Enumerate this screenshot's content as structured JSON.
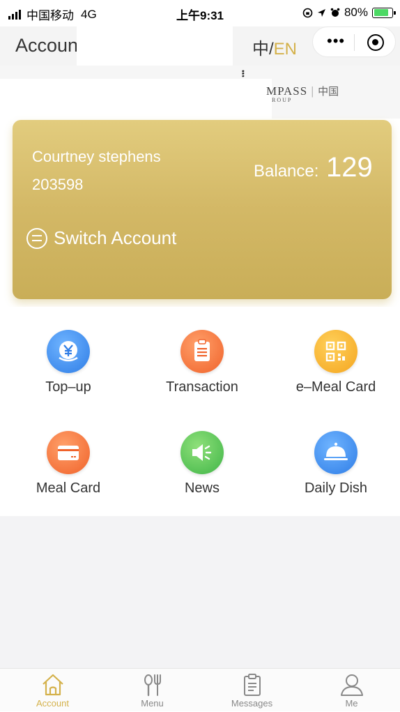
{
  "status_bar": {
    "carrier": "中国移动",
    "network": "4G",
    "time": "上午9:31",
    "battery": "80%"
  },
  "nav": {
    "title": "Accoun",
    "lang_zh": "中",
    "lang_sep": "/",
    "lang_en": "EN",
    "more_icon": "ellipsis-icon",
    "close_icon": "target-icon",
    "active_lang_color": "#d4b14a"
  },
  "banner": {
    "logo_text": "MPASS",
    "logo_zh": "中国",
    "logo_sub": "ROUP"
  },
  "card": {
    "name": "Courtney stephens",
    "number": "203598",
    "balance_label": "Balance:",
    "balance_value": "129",
    "switch_label": "Switch Account",
    "switch_icon": "swap-icon",
    "gradient_top": "#e2cc7e",
    "gradient_bottom": "#c9ae58"
  },
  "menu": [
    {
      "label": "Top–up",
      "icon": "yen-icon",
      "color": "#2f7de6"
    },
    {
      "label": "Transaction",
      "icon": "clipboard-icon",
      "color": "#f0622a"
    },
    {
      "label": "e–Meal Card",
      "icon": "qr-code-icon",
      "color": "#f4a51f"
    },
    {
      "label": "Meal Card",
      "icon": "card-icon",
      "color": "#f0622a"
    },
    {
      "label": "News",
      "icon": "megaphone-icon",
      "color": "#3fb547"
    },
    {
      "label": "Daily Dish",
      "icon": "cloche-icon",
      "color": "#2f7de6"
    }
  ],
  "tabs": [
    {
      "label": "Account",
      "icon": "home-icon",
      "active": true
    },
    {
      "label": "Menu",
      "icon": "utensils-icon",
      "active": false
    },
    {
      "label": "Messages",
      "icon": "clipboard-list-icon",
      "active": false
    },
    {
      "label": "Me",
      "icon": "user-icon",
      "active": false
    }
  ]
}
